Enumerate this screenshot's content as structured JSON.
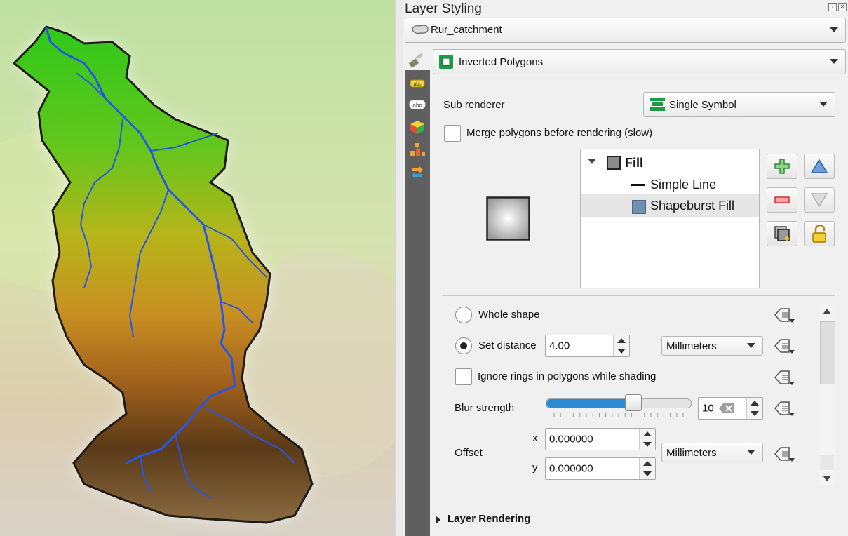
{
  "panel": {
    "title": "Layer Styling",
    "layer_combo": {
      "value": "Rur_catchment"
    },
    "renderer_combo": {
      "value": "Inverted Polygons"
    },
    "sub_renderer": {
      "label": "Sub renderer",
      "value": "Single Symbol"
    },
    "merge_checkbox": {
      "label": "Merge polygons before rendering (slow)",
      "checked": false
    },
    "symbol_tree": {
      "items": [
        {
          "label": "Fill",
          "bold": true
        },
        {
          "label": "Simple Line"
        },
        {
          "label": "Shapeburst Fill",
          "selected": true
        }
      ]
    },
    "shading": {
      "whole_shape_label": "Whole shape",
      "set_distance_label": "Set distance",
      "set_distance_selected": true,
      "distance_value": "4.00",
      "distance_unit": "Millimeters",
      "ignore_rings_label": "Ignore rings in polygons while shading",
      "blur_label": "Blur strength",
      "blur_value": "10",
      "blur_level_fraction": 0.6,
      "offset_label": "Offset",
      "offset_x_label": "x",
      "offset_x_value": "0.000000",
      "offset_y_label": "y",
      "offset_y_value": "0.000000",
      "offset_unit": "Millimeters"
    },
    "layer_rendering_label": "Layer Rendering"
  },
  "colors": {
    "accent_green": "#1a9b46",
    "slider_blue": "#2a8ad4",
    "river_blue": "#2457e8",
    "side_toolbar": "#5f5f5f"
  },
  "icons": [
    "paintbrush-icon",
    "labels-icon",
    "abc-icon",
    "3d-cube-icon",
    "diagram-icon",
    "history-icon",
    "polygon-layer-icon",
    "inverted-polygon-icon",
    "single-symbol-icon",
    "add-symbol-layer-icon",
    "remove-symbol-layer-icon",
    "duplicate-layer-icon",
    "lock-icon",
    "move-up-icon",
    "move-down-icon",
    "data-defined-icon"
  ]
}
